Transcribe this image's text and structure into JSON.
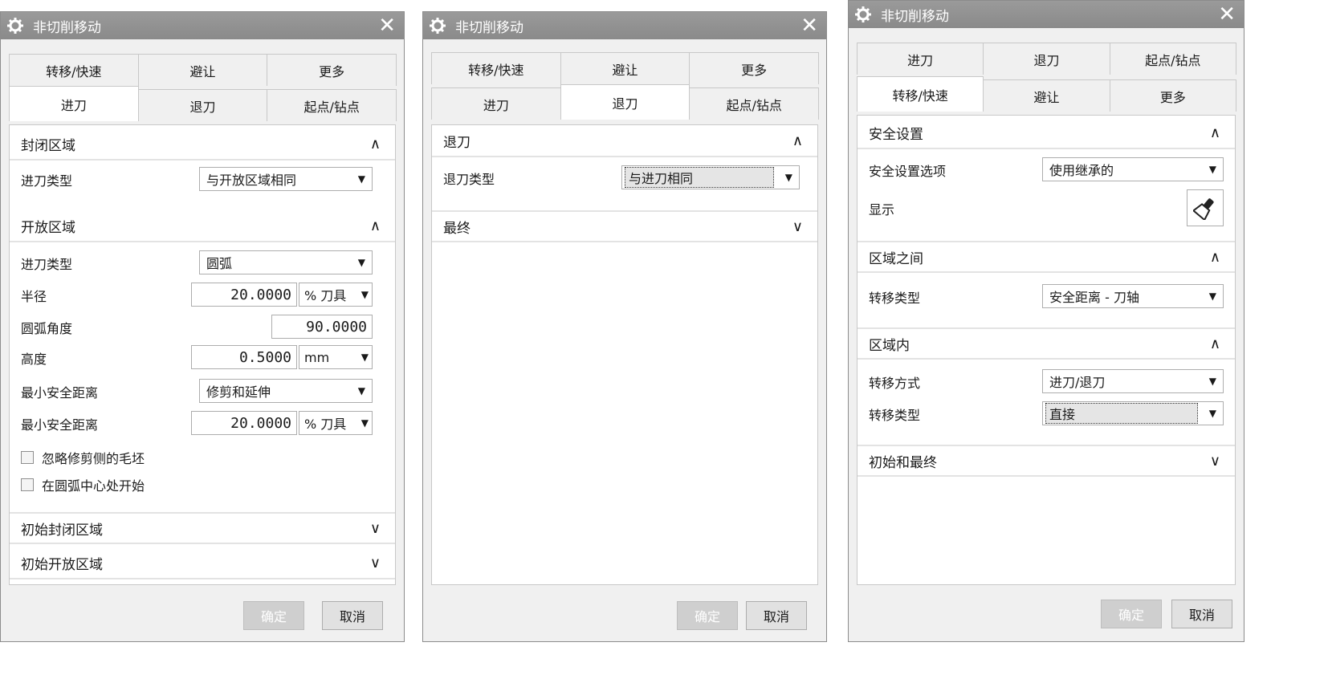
{
  "dialogs": [
    {
      "title": "非切削移动",
      "tabs_row1": [
        "转移/快速",
        "避让",
        "更多"
      ],
      "tabs_row2": [
        "进刀",
        "退刀",
        "起点/钻点"
      ],
      "active_tab": "进刀",
      "sections": {
        "closed_area": "封闭区域",
        "open_area": "开放区域",
        "initial_closed": "初始封闭区域",
        "initial_open": "初始开放区域"
      },
      "closed_engage_type_label": "进刀类型",
      "closed_engage_type_value": "与开放区域相同",
      "open_engage_type_label": "进刀类型",
      "open_engage_type_value": "圆弧",
      "radius_label": "半径",
      "radius_value": "20.0000",
      "radius_unit": "% 刀具",
      "arc_angle_label": "圆弧角度",
      "arc_angle_value": "90.0000",
      "height_label": "高度",
      "height_value": "0.5000",
      "height_unit": "mm",
      "min_clear_label_1": "最小安全距离",
      "min_clear_value_1": "修剪和延伸",
      "min_clear_label_2": "最小安全距离",
      "min_clear_value_2": "20.0000",
      "min_clear_unit_2": "% 刀具",
      "checkbox_1": "忽略修剪侧的毛坯",
      "checkbox_2": "在圆弧中心处开始",
      "ok": "确定",
      "cancel": "取消"
    },
    {
      "title": "非切削移动",
      "tabs_row1": [
        "转移/快速",
        "避让",
        "更多"
      ],
      "tabs_row2": [
        "进刀",
        "退刀",
        "起点/钻点"
      ],
      "active_tab": "退刀",
      "section_retract": "退刀",
      "retract_type_label": "退刀类型",
      "retract_type_value": "与进刀相同",
      "section_final": "最终",
      "ok": "确定",
      "cancel": "取消"
    },
    {
      "title": "非切削移动",
      "tabs_row1": [
        "进刀",
        "退刀",
        "起点/钻点"
      ],
      "tabs_row2": [
        "转移/快速",
        "避让",
        "更多"
      ],
      "active_tab": "转移/快速",
      "section_safety": "安全设置",
      "safety_option_label": "安全设置选项",
      "safety_option_value": "使用继承的",
      "display_label": "显示",
      "section_between": "区域之间",
      "between_type_label": "转移类型",
      "between_type_value": "安全距离 - 刀轴",
      "section_within": "区域内",
      "within_method_label": "转移方式",
      "within_method_value": "进刀/退刀",
      "within_type_label": "转移类型",
      "within_type_value": "直接",
      "section_initial_final": "初始和最终",
      "ok": "确定",
      "cancel": "取消"
    }
  ],
  "icons": {
    "title": "gear-icon",
    "close": "close-icon",
    "expanded": "chevron-up-icon",
    "collapsed": "chevron-down-icon",
    "dropdown": "dropdown-arrow-icon",
    "display": "flashlight-icon"
  },
  "colors": {
    "titlebar": "#8f8f8f",
    "dialog_bg": "#f0f0f0",
    "panel_bg": "#ffffff"
  }
}
